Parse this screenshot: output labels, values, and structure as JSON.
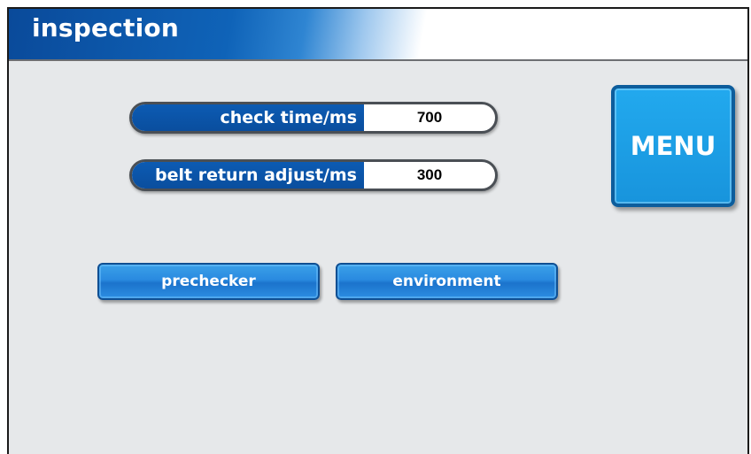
{
  "header": {
    "title": "inspection"
  },
  "params": [
    {
      "label": "check time/ms",
      "value": "700"
    },
    {
      "label": "belt return adjust/ms",
      "value": "300"
    }
  ],
  "buttons": {
    "prechecker": "prechecker",
    "environment": "environment",
    "menu": "MENU"
  },
  "colors": {
    "header_blue": "#0a4a9a",
    "button_blue": "#2a8ae0",
    "menu_cyan": "#22a9ee",
    "background": "#e6e8ea"
  }
}
